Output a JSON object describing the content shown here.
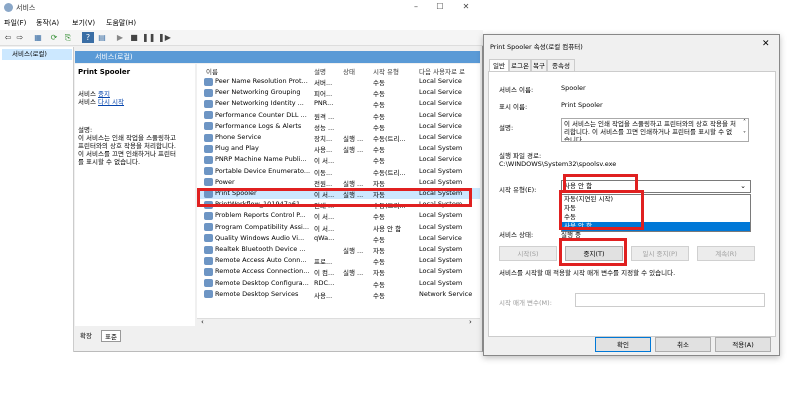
{
  "window": {
    "title": "서비스",
    "min": "–",
    "max": "☐",
    "close": "✕"
  },
  "menu": [
    "파일(F)",
    "동작(A)",
    "보기(V)",
    "도움말(H)"
  ],
  "tree": {
    "root": "서비스(로컬)"
  },
  "pane": {
    "header": "서비스(로컬)",
    "selected_name": "Print Spooler",
    "action1_prefix": "서비스 ",
    "action1_link": "중지",
    "action2_prefix": "서비스 ",
    "action2_link": "다시 시작",
    "desc_label": "설명:",
    "desc_text": [
      "이 서비스는 인쇄 작업을 스풀링하고",
      "프린터와의 상호 작용을 처리합니다.",
      "이 서비스를 끄면 인쇄하거나 프린터",
      "를 표시할 수 없습니다."
    ]
  },
  "columns": [
    "이름",
    "설명",
    "상태",
    "시작 유형",
    "다음 사용자로 로"
  ],
  "rows": [
    [
      "Peer Name Resolution Prot...",
      "서버...",
      "",
      "수동",
      "Local Service"
    ],
    [
      "Peer Networking Grouping",
      "피어...",
      "",
      "수동",
      "Local Service"
    ],
    [
      "Peer Networking Identity ...",
      "PNR...",
      "",
      "수동",
      "Local Service"
    ],
    [
      "Performance Counter DLL ...",
      "원격 ...",
      "",
      "수동",
      "Local Service"
    ],
    [
      "Performance Logs & Alerts",
      "성능 ...",
      "",
      "수동",
      "Local Service"
    ],
    [
      "Phone Service",
      "장치...",
      "실행 ...",
      "수동(트리...",
      "Local Service"
    ],
    [
      "Plug and Play",
      "사용...",
      "실행 ...",
      "수동",
      "Local System"
    ],
    [
      "PNRP Machine Name Publi...",
      "이 서...",
      "",
      "수동",
      "Local Service"
    ],
    [
      "Portable Device Enumerato...",
      "이동...",
      "",
      "수동(트리...",
      "Local System"
    ],
    [
      "Power",
      "전원...",
      "실행 ...",
      "자동",
      "Local System"
    ],
    [
      "Print Spooler",
      "이 서...",
      "실행 ...",
      "자동",
      "Local System"
    ],
    [
      "PrintWorkflow_101947a61",
      "인쇄 ...",
      "",
      "수동(트리...",
      "Local System"
    ],
    [
      "Problem Reports Control P...",
      "이 서...",
      "",
      "수동",
      "Local System"
    ],
    [
      "Program Compatibility Assi...",
      "이 서...",
      "",
      "사용 안 함",
      "Local System"
    ],
    [
      "Quality Windows Audio Vi...",
      "qWa...",
      "",
      "수동",
      "Local Service"
    ],
    [
      "Realtek Bluetooth Device ...",
      "",
      "실행 ...",
      "자동",
      "Local System"
    ],
    [
      "Remote Access Auto Conn...",
      "프로...",
      "",
      "수동",
      "Local System"
    ],
    [
      "Remote Access Connection...",
      "이 컴...",
      "실행 ...",
      "자동",
      "Local System"
    ],
    [
      "Remote Desktop Configura...",
      "RDC...",
      "",
      "수동",
      "Local System"
    ],
    [
      "Remote Desktop Services",
      "사용...",
      "",
      "수동",
      "Network Service"
    ]
  ],
  "bottom_tabs": [
    "확장",
    "표준"
  ],
  "dialog": {
    "title": "Print Spooler 속성(로컬 컴퓨터)",
    "close": "✕",
    "tabs": [
      "일반",
      "로그온",
      "복구",
      "종속성"
    ],
    "service_name_label": "서비스 이름:",
    "service_name": "Spooler",
    "display_name_label": "표시 이름:",
    "display_name": "Print Spooler",
    "desc_label": "설명:",
    "desc_text": "이 서비스는 인쇄 작업을 스풀링하고 프린터와의 상호 작용을 처리합니다. 이 서비스를 끄면 인쇄하거나 프린터를 표시할 수 없습니다.",
    "path_label": "실행 파일 경로:",
    "path": "C:\\WINDOWS\\System32\\spoolsv.exe",
    "startup_label": "시작 유형(E):",
    "startup_value": "사용 안 함",
    "startup_options": [
      "자동(지연된 시작)",
      "자동",
      "수동",
      "사용 안 함"
    ],
    "status_label": "서비스 상태:",
    "status_value": "실행 중",
    "buttons": {
      "start": "시작(S)",
      "stop": "중지(T)",
      "pause": "일시 중지(P)",
      "resume": "계속(R)"
    },
    "param_hint": "서비스를 시작할 때 적용할 시작 매개 변수를 지정할 수 있습니다.",
    "param_label": "시작 매개 변수(M):",
    "ok": "확인",
    "cancel": "취소",
    "apply": "적용(A)"
  }
}
